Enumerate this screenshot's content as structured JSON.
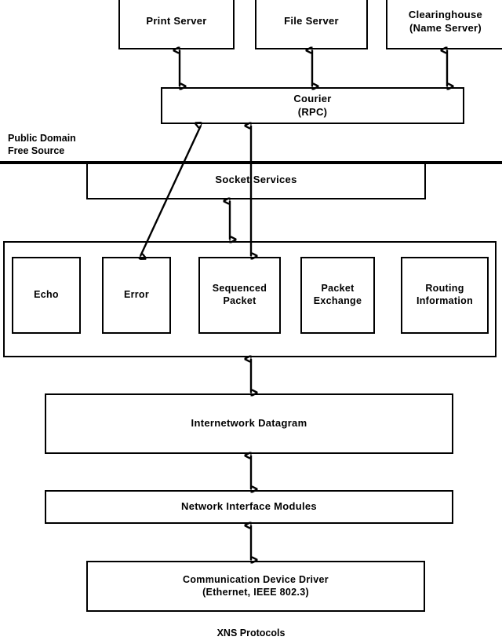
{
  "diagram": {
    "caption": "XNS Protocols",
    "side_note": "Public Domain\nFree Source",
    "layers": {
      "applications": [
        {
          "id": "print-server",
          "label": "Print Server"
        },
        {
          "id": "file-server",
          "label": "File Server"
        },
        {
          "id": "clearinghouse",
          "label": "Clearinghouse\n(Name Server)"
        }
      ],
      "courier": {
        "id": "courier",
        "label": "Courier\n(RPC)"
      },
      "socket_services": {
        "id": "socket-services",
        "label": "Socket  Services"
      },
      "transport": [
        {
          "id": "echo",
          "label": "Echo"
        },
        {
          "id": "error",
          "label": "Error"
        },
        {
          "id": "sequenced-packet",
          "label": "Sequenced\nPacket"
        },
        {
          "id": "packet-exchange",
          "label": "Packet\nExchange"
        },
        {
          "id": "routing-information",
          "label": "Routing\nInformation"
        }
      ],
      "internetwork_datagram": {
        "id": "internetwork-datagram",
        "label": "Internetwork Datagram"
      },
      "network_interface_modules": {
        "id": "network-interface-modules",
        "label": "Network  Interface Modules"
      },
      "communication_device_driver": {
        "id": "communication-device-driver",
        "label": "Communication Device Driver\n(Ethernet, IEEE 802.3)"
      }
    },
    "colors": {
      "stroke": "#000000",
      "fill": "#ffffff",
      "text": "#000000"
    }
  }
}
